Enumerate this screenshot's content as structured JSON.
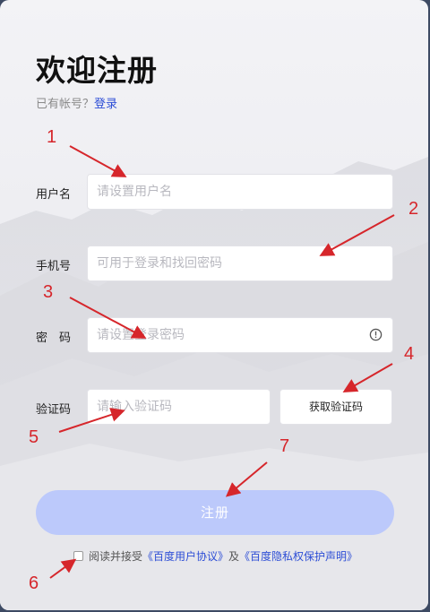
{
  "header": {
    "title": "欢迎注册",
    "have_account": "已有帐号？",
    "login_link": "登录"
  },
  "form": {
    "username": {
      "label": "用户名",
      "placeholder": "请设置用户名"
    },
    "phone": {
      "label": "手机号",
      "placeholder": "可用于登录和找回密码"
    },
    "password": {
      "label": "密　码",
      "placeholder": "请设置登录密码"
    },
    "code": {
      "label": "验证码",
      "placeholder": "请输入验证码",
      "button": "获取验证码"
    }
  },
  "submit": {
    "label": "注册"
  },
  "agreement": {
    "prefix": "阅读并接受",
    "user_agreement": "《百度用户协议》",
    "and": "及",
    "privacy": "《百度隐私权保护声明》"
  },
  "annotations": [
    "1",
    "2",
    "3",
    "4",
    "5",
    "6",
    "7"
  ],
  "colors": {
    "accent": "#2c4dd6",
    "submit_bg": "#bcc9fb",
    "annotation": "#d6262b"
  }
}
